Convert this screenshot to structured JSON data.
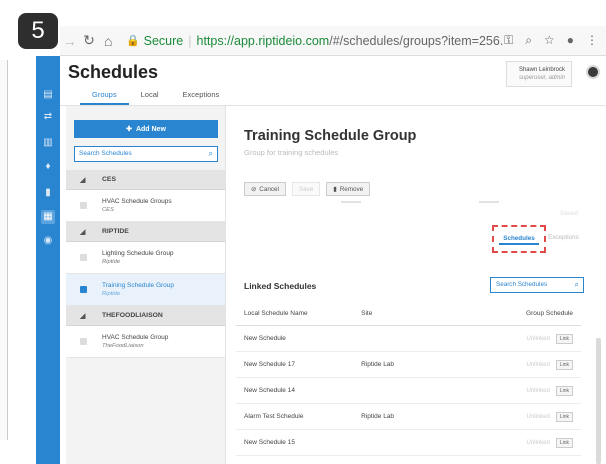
{
  "badge": "5",
  "browser": {
    "secure_label": "Secure",
    "url_host": "https://app.riptideio.com",
    "url_rest": "/#/schedules/groups?item=256..."
  },
  "app": {
    "title": "Schedules",
    "tabs": [
      "Groups",
      "Local",
      "Exceptions"
    ],
    "user": {
      "name": "Shawn Leinbrock",
      "role": "superuser, admin"
    }
  },
  "left_panel": {
    "add_label": "Add New",
    "search_placeholder": "Search Schedules",
    "groups": [
      {
        "name": "CES",
        "items": [
          {
            "name": "HVAC Schedule Groups",
            "sub": "CES"
          }
        ]
      },
      {
        "name": "RIPTIDE",
        "items": [
          {
            "name": "Lighting Schedule Group",
            "sub": "Riptide"
          },
          {
            "name": "Training Schedule Group",
            "sub": "Riptide"
          }
        ]
      },
      {
        "name": "THEFOODLIAISON",
        "items": [
          {
            "name": "HVAC Schedule Group",
            "sub": "TheFoodLiaison"
          }
        ]
      }
    ]
  },
  "detail": {
    "title": "Training Schedule Group",
    "subtitle": "Group for training schedules",
    "actions": {
      "cancel": "Cancel",
      "save": "Save",
      "remove": "Remove"
    },
    "faint_label": "Saved",
    "subtabs": {
      "schedules": "Schedules",
      "exceptions": "Exceptions"
    },
    "linked": {
      "title": "Linked Schedules",
      "search_placeholder": "Search Schedules",
      "columns": [
        "Local Schedule Name",
        "Site",
        "Group Schedule"
      ],
      "rows": [
        {
          "name": "New Schedule",
          "site": "",
          "status": "Unlinked",
          "btn": "Link"
        },
        {
          "name": "New Schedule 17",
          "site": "Riptide Lab",
          "status": "Unlinked",
          "btn": "Link"
        },
        {
          "name": "New Schedule 14",
          "site": "",
          "status": "Unlinked",
          "btn": "Link"
        },
        {
          "name": "Alarm Test Schedule",
          "site": "Riptide Lab",
          "status": "Unlinked",
          "btn": "Link"
        },
        {
          "name": "New Schedule 15",
          "site": "",
          "status": "Unlinked",
          "btn": "Link"
        }
      ]
    }
  }
}
